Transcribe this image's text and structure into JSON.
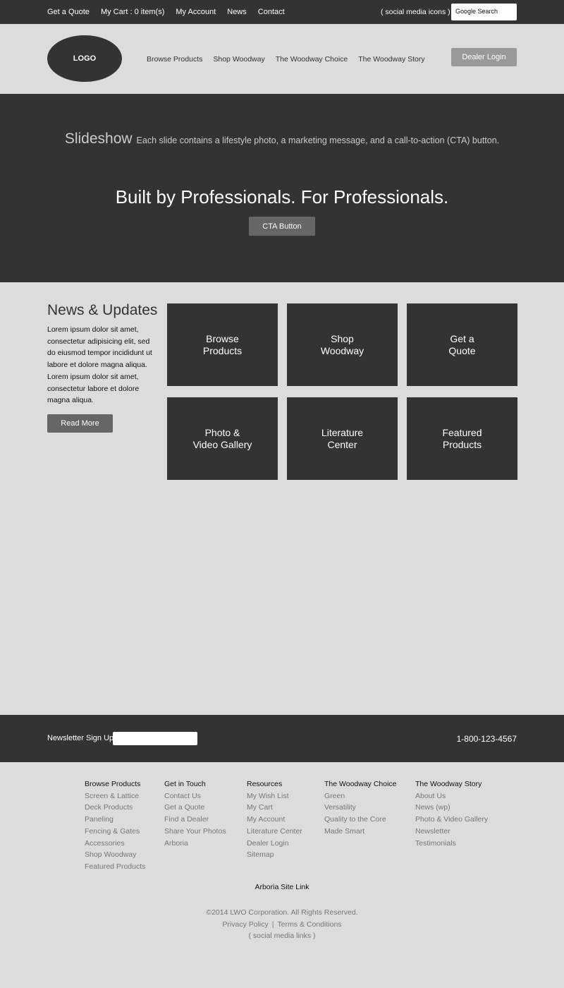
{
  "topbar": {
    "links": [
      "Get a Quote",
      "My Cart : 0 item(s)",
      "My Account",
      "News",
      "Contact"
    ],
    "social_icons": "( social media icons )",
    "search_placeholder": "Google Search"
  },
  "header": {
    "logo": "LOGO",
    "nav": [
      "Browse Products",
      "Shop Woodway",
      "The Woodway Choice",
      "The Woodway Story"
    ],
    "dealer_login": "Dealer Login"
  },
  "hero": {
    "title": "Slideshow",
    "description": "Each slide contains a lifestyle photo, a marketing message, and a call-to-action (CTA) button.",
    "headline": "Built by Professionals. For Professionals.",
    "cta": "CTA Button"
  },
  "news": {
    "title": "News & Updates",
    "body": "Lorem ipsum dolor sit amet, consectetur adipisicing elit, sed do eiusmod tempor incididunt ut labore et dolore magna aliqua. Lorem ipsum dolor sit amet, consectetur labore et dolore magna aliqua.",
    "read_more": "Read More"
  },
  "tiles": [
    "Browse\nProducts",
    "Shop\nWoodway",
    "Get a\nQuote",
    "Photo &\nVideo Gallery",
    "Literature\nCenter",
    "Featured\nProducts"
  ],
  "footer": {
    "newsletter_label": "Newsletter Sign Up",
    "phone": "1-800-123-4567",
    "columns": [
      {
        "heading": "Browse Products",
        "links": [
          "Screen & Lattice",
          "Deck Products",
          "Paneling",
          "Fencing & Gates",
          "Accessories",
          "Shop Woodway",
          "Featured Products"
        ]
      },
      {
        "heading": "Get in Touch",
        "links": [
          "Contact Us",
          "Get a Quote",
          "Find a Dealer",
          "Share Your Photos",
          "Arboria"
        ]
      },
      {
        "heading": "Resources",
        "links": [
          "My Wish List",
          "My Cart",
          "My Account",
          "Literature Center",
          "Dealer Login",
          "Sitemap"
        ]
      },
      {
        "heading": "The Woodway Choice",
        "links": [
          "Green",
          "Versatility",
          "Quality to the Core",
          "Made Smart"
        ]
      },
      {
        "heading": "The Woodway Story",
        "links": [
          "About Us",
          "News (wp)",
          "Photo & Video Gallery",
          "Newsletter",
          "Testimonials"
        ]
      }
    ],
    "arboria_link": "Arboria Site Link",
    "copyright": "©2014 LWO Corporation. All Rights Reserved.",
    "privacy": "Privacy Policy",
    "separator": "|",
    "terms": "Terms & Conditions",
    "social_links": "( social media links )"
  },
  "colors": {
    "dark": "#333333",
    "background": "#dcdcdc",
    "button_gray": "#666666",
    "dealer_button": "#999999"
  }
}
